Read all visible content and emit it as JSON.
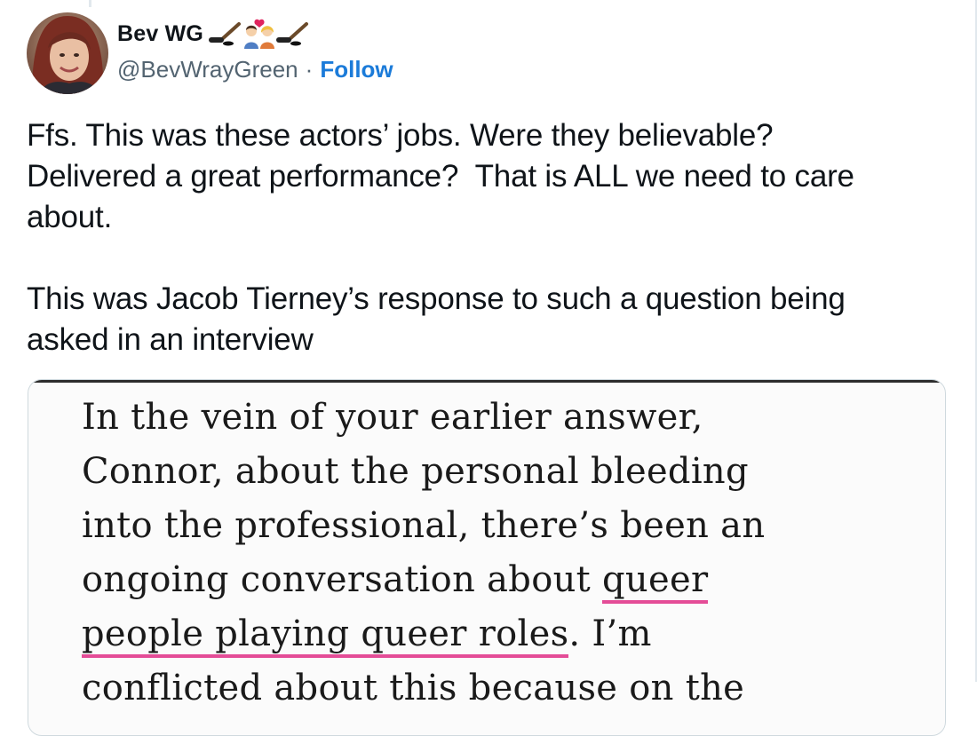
{
  "tweet": {
    "author": {
      "display_name": "Bev WG",
      "handle": "@BevWrayGreen",
      "emoji_badges": [
        "hockey-stick-icon",
        "couple-with-heart-icon",
        "hockey-stick-icon"
      ]
    },
    "separator": "·",
    "follow_label": "Follow",
    "paragraphs": [
      "Ffs. This was these actors’ jobs. Were they believable?\nDelivered a great performance?  That is ALL we need to care\nabout.",
      "This was Jacob Tierney’s response to such a question being\nasked in an interview"
    ]
  },
  "media": {
    "quote_lines": [
      {
        "before": "In the vein of your earlier answer,",
        "highlight": "",
        "after": ""
      },
      {
        "before": "Connor, about the personal bleeding",
        "highlight": "",
        "after": ""
      },
      {
        "before": "into the professional, there’s been an",
        "highlight": "",
        "after": ""
      },
      {
        "before": "ongoing conversation about ",
        "highlight": "queer",
        "after": ""
      },
      {
        "before": "",
        "highlight": "people playing queer roles",
        "after": ". I’m"
      },
      {
        "before": "conflicted about this because on the",
        "highlight": "",
        "after": ""
      }
    ],
    "highlight_color": "#e44c97"
  },
  "colors": {
    "link": "#1b7bd9",
    "secondary_text": "#536471",
    "card_border": "#cfd9de"
  }
}
